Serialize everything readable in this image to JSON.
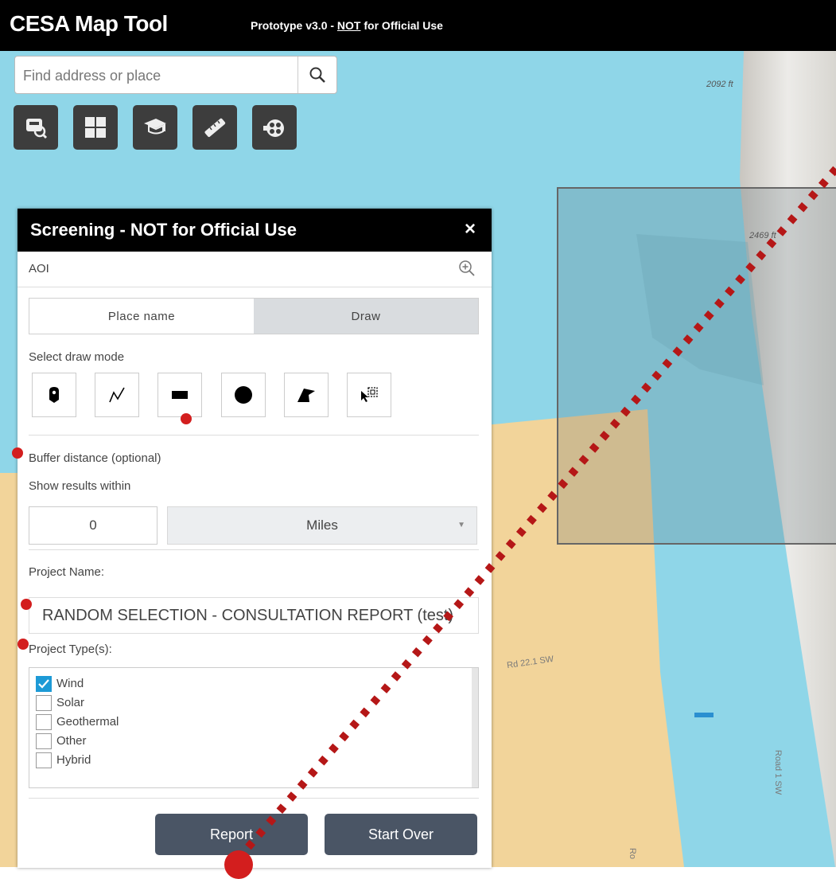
{
  "header": {
    "app_title": "CESA Map Tool",
    "subtitle_prefix": "Prototype v3.0 - ",
    "subtitle_not": "NOT",
    "subtitle_suffix": " for Official Use"
  },
  "search": {
    "placeholder": "Find address or place",
    "icon": "search-icon"
  },
  "toolbar": {
    "tools": [
      {
        "name": "layer-list-icon"
      },
      {
        "name": "basemap-gallery-icon"
      },
      {
        "name": "learn-icon"
      },
      {
        "name": "measure-icon"
      },
      {
        "name": "screening-icon"
      }
    ]
  },
  "map": {
    "elevation_labels": [
      "2092 ft",
      "2469 ft"
    ],
    "road_labels": [
      "Rd 22.1 SW",
      "Road 1 SW",
      "Ro"
    ]
  },
  "panel": {
    "title": "Screening - NOT for Official Use",
    "close": "×",
    "aoi_label": "AOI",
    "tabs": [
      {
        "label": "Place name",
        "active": false
      },
      {
        "label": "Draw",
        "active": true
      }
    ],
    "draw_mode_label": "Select draw mode",
    "draw_modes": [
      "point-icon",
      "polyline-icon",
      "rectangle-icon",
      "circle-icon",
      "polygon-icon",
      "select-feature-icon"
    ],
    "buffer_label": "Buffer distance (optional)",
    "show_results_label": "Show results within",
    "buffer_value": "0",
    "buffer_units": "Miles",
    "project_name_label": "Project Name:",
    "project_name_value": "RANDOM SELECTION - CONSULTATION REPORT (test)",
    "project_types_label": "Project Type(s):",
    "project_types": [
      {
        "label": "Wind",
        "checked": true
      },
      {
        "label": "Solar",
        "checked": false
      },
      {
        "label": "Geothermal",
        "checked": false
      },
      {
        "label": "Other",
        "checked": false
      },
      {
        "label": "Hybrid",
        "checked": false
      }
    ],
    "report_button": "Report",
    "start_over_button": "Start Over"
  },
  "colors": {
    "water_blue": "#8fd6e8",
    "sand": "#f2d49a",
    "annotation_red": "#d31e1e",
    "button": "#4a5565",
    "checkbox": "#1d9ad6"
  }
}
